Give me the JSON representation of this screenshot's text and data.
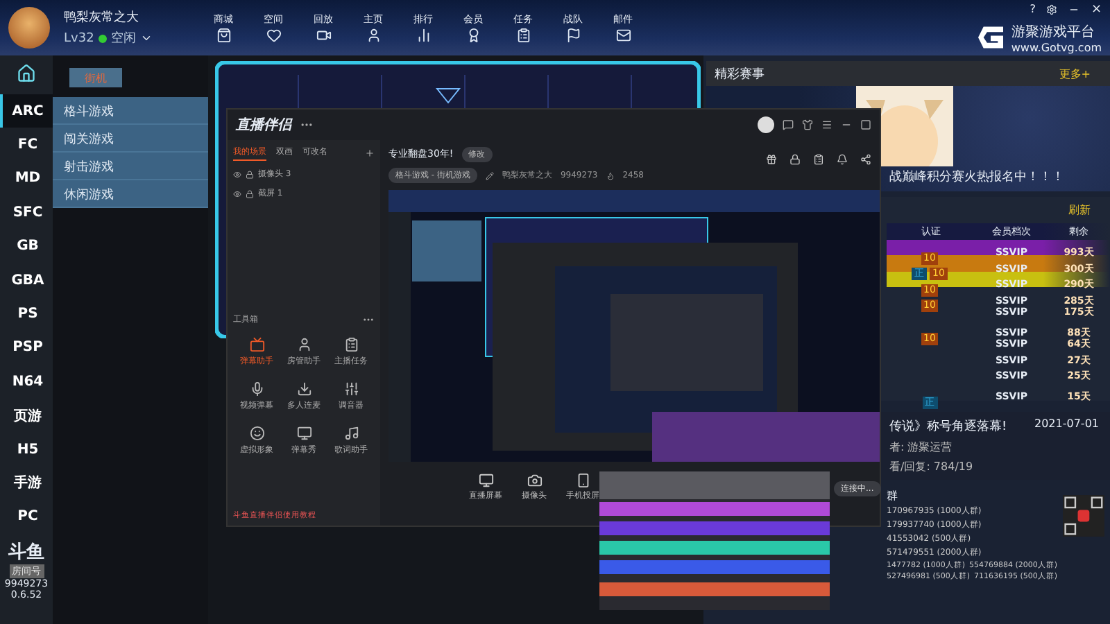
{
  "user": {
    "name": "鸭梨灰常之大",
    "level": "Lv32",
    "status": "空闲"
  },
  "nav": [
    "商城",
    "空间",
    "回放",
    "主页",
    "排行",
    "会员",
    "任务",
    "战队",
    "邮件"
  ],
  "window_controls": [
    "?",
    "×"
  ],
  "brand": {
    "name": "游聚游戏平台",
    "url": "www.Gotvg.com"
  },
  "platforms": [
    {
      "label": "ARC",
      "selected": true
    },
    {
      "label": "FC",
      "selected": false
    },
    {
      "label": "MD",
      "selected": false
    },
    {
      "label": "SFC",
      "selected": false
    },
    {
      "label": "GB",
      "selected": false
    },
    {
      "label": "GBA",
      "selected": false
    },
    {
      "label": "PS",
      "selected": false
    },
    {
      "label": "PSP",
      "selected": false
    },
    {
      "label": "N64",
      "selected": false
    },
    {
      "label": "页游",
      "selected": false
    },
    {
      "label": "H5",
      "selected": false
    },
    {
      "label": "手游",
      "selected": false
    },
    {
      "label": "PC",
      "selected": false
    }
  ],
  "room": {
    "logo": "斗鱼",
    "label": "房间号",
    "number": "9949273"
  },
  "version": "0.6.52",
  "submenu": {
    "tab": "街机",
    "items": [
      "格斗游戏",
      "闯关游戏",
      "射击游戏",
      "休闲游戏"
    ]
  },
  "events": {
    "title": "精彩赛事",
    "more": "更多+",
    "headline": "战巅峰积分赛火热报名中！！！"
  },
  "ranking": {
    "refresh": "刷新",
    "columns": [
      "认证",
      "会员档次",
      "剩余"
    ],
    "rows": [
      {
        "badges": [
          "10"
        ],
        "tier": "SSVIP",
        "remaining": "993天",
        "color": "#7a1fa8"
      },
      {
        "badges": [
          "正",
          "10"
        ],
        "tier": "SSVIP",
        "remaining": "300天",
        "color": "#c87a10"
      },
      {
        "badges": [
          "10"
        ],
        "tier": "SSVIP",
        "remaining": "290天",
        "color": "#c8c010"
      },
      {
        "badges": [
          "10"
        ],
        "tier": "SSVIP",
        "remaining": "285天"
      },
      {
        "badges": [],
        "tier": "SSVIP",
        "remaining": "175天"
      },
      {
        "badges": [
          "10"
        ],
        "tier": "SSVIP",
        "remaining": "88天"
      },
      {
        "badges": [],
        "tier": "SSVIP",
        "remaining": "64天"
      },
      {
        "badges": [],
        "tier": "SSVIP",
        "remaining": "27天"
      },
      {
        "badges": [],
        "tier": "SSVIP",
        "remaining": "25天"
      },
      {
        "badges": [
          "正"
        ],
        "tier": "SSVIP",
        "remaining": "15天"
      }
    ]
  },
  "news": {
    "title": "传说》称号角逐落幕!",
    "date": "2021-07-01",
    "author": "者: 游聚运营",
    "stats": "看/回复: 784/19"
  },
  "groups": {
    "title": "群",
    "items": [
      "170967935 (1000人群)",
      "179937740 (1000人群)",
      "41553042 (500人群)",
      "571479551 (2000人群)"
    ],
    "pairs": [
      [
        "1477782 (1000人群)",
        "554769884 (2000人群)"
      ],
      [
        "527496981 (500人群)",
        "711636195 (500人群)"
      ]
    ]
  },
  "streamer": {
    "title": "直播伴侣",
    "tabs": [
      {
        "label": "我的场景",
        "selected": true
      },
      {
        "label": "双画",
        "selected": false
      },
      {
        "label": "可改名",
        "selected": false
      }
    ],
    "sources": [
      "摄像头 3",
      "截屏 1"
    ],
    "toolbox": "工具箱",
    "tools": [
      "弹幕助手",
      "房管助手",
      "主播任务",
      "视频弹幕",
      "多人连麦",
      "调音器",
      "虚拟形象",
      "弹幕秀",
      "歌词助手"
    ],
    "stream_title": "专业翻盘30年!",
    "edit": "修改",
    "category": "格斗游戏 - 街机游戏",
    "host": "鸭梨灰常之大",
    "room_id": "9949273",
    "heat": "2458",
    "actions": [
      "直播屏幕",
      "摄像头",
      "手机投屏"
    ],
    "connecting": "连接中...",
    "tutorial": "斗鱼直播伴侣使用教程"
  }
}
